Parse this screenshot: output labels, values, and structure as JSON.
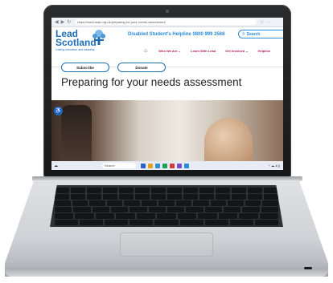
{
  "browser": {
    "url": "https://www.lead.org.uk/preparing-for-your-needs-assessment",
    "nav_icons": [
      "◀",
      "▶",
      "↻"
    ],
    "right_icons": [
      "☆",
      "⋯"
    ]
  },
  "site": {
    "logo_line1": "Lead",
    "logo_line2": "Scotland",
    "logo_tagline": "Linking education and disability",
    "helpline": "Disabled Student's Helpline 0800 999 2568",
    "search_label": "Search",
    "nav": [
      {
        "label": "Who We Are ⌄"
      },
      {
        "label": "Learn With Lead"
      },
      {
        "label": "Get Involved ⌄"
      },
      {
        "label": "Helpline"
      }
    ],
    "subscribe_label": "Subscribe",
    "donate_label": "Donate",
    "page_heading": "Preparing for your needs assessment"
  },
  "taskbar": {
    "search_label": "Search",
    "app_colors": [
      "#2c63c9",
      "#e3a21a",
      "#2f8fd8",
      "#1f9d55",
      "#d23a2f",
      "#7b4dc4",
      "#2a8bd8"
    ],
    "tray": "^ ☁ ◂ ))"
  },
  "colors": {
    "brand_blue": "#1f6eb5",
    "helpline_blue": "#2a8bd8",
    "nav_magenta": "#b3195e"
  }
}
